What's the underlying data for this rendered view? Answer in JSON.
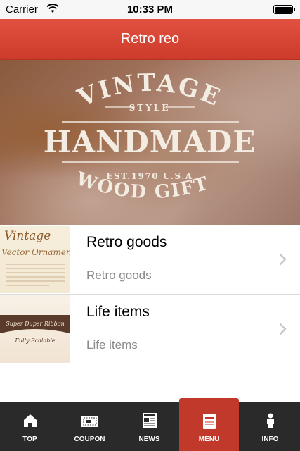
{
  "status_bar": {
    "carrier": "Carrier",
    "time": "10:33 PM"
  },
  "nav": {
    "title": "Retro reo"
  },
  "hero": {
    "line1": "VINTAGE",
    "line2": "STYLE",
    "line3": "HANDMADE",
    "line4": "EST.1970 U.S.A",
    "line5": "WOOD GIFTS"
  },
  "list": {
    "items": [
      {
        "title": "Retro goods",
        "subtitle": "Retro goods",
        "thumb_heading": "Vintage",
        "thumb_subheading": "Vector Ornaments"
      },
      {
        "title": "Life items",
        "subtitle": "Life items",
        "thumb_heading": "Super Duper Ribbon",
        "thumb_subheading": "Fully Scalable"
      }
    ]
  },
  "tabs": [
    {
      "label": "TOP",
      "icon": "home-icon",
      "active": false
    },
    {
      "label": "COUPON",
      "icon": "coupon-icon",
      "active": false
    },
    {
      "label": "NEWS",
      "icon": "newspaper-icon",
      "active": false
    },
    {
      "label": "MENU",
      "icon": "menu-book-icon",
      "active": true
    },
    {
      "label": "INFO",
      "icon": "info-person-icon",
      "active": false
    }
  ],
  "colors": {
    "accent": "#d9473a",
    "tab_bar": "#2a2a2a",
    "tab_active": "#c0392b"
  }
}
